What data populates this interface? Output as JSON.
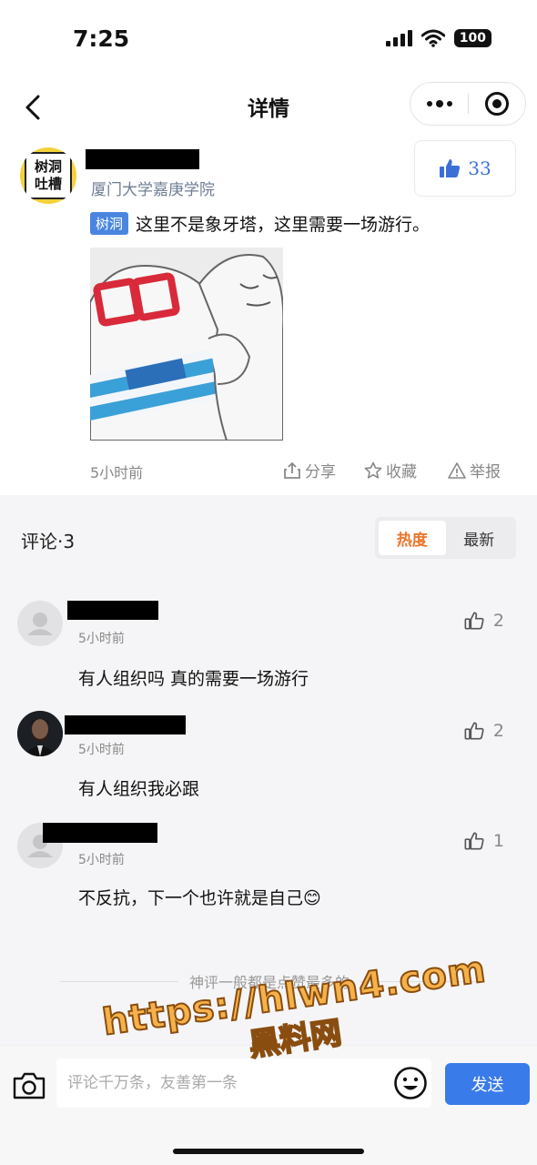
{
  "status_bar": {
    "time": "7:25",
    "battery": "100"
  },
  "nav": {
    "title": "详情"
  },
  "post": {
    "avatar_text_line1": "树洞",
    "avatar_text_line2": "吐槽",
    "school": "厦门大学嘉庚学院",
    "likes": "33",
    "tag": "树洞",
    "text": "这里不是象牙塔，这里需要一场游行。",
    "time": "5小时前",
    "actions": {
      "share": "分享",
      "favorite": "收藏",
      "report": "举报"
    }
  },
  "comments_section": {
    "title": "评论·3",
    "sort_tabs": [
      {
        "label": "热度",
        "active": true
      },
      {
        "label": "最新",
        "active": false
      }
    ],
    "comments": [
      {
        "time": "5小时前",
        "text": "有人组织吗 真的需要一场游行",
        "likes": "2"
      },
      {
        "time": "5小时前",
        "text": "有人组织我必跟",
        "likes": "2"
      },
      {
        "time": "5小时前",
        "text": "不反抗，下一个也许就是自己😊",
        "likes": "1"
      }
    ],
    "tip": "神评一般都是点赞最多的"
  },
  "input_bar": {
    "placeholder": "评论千万条，友善第一条",
    "send_label": "发送"
  },
  "watermark": {
    "line1": "https://hlwn4.com",
    "line2": "黑料网"
  },
  "colors": {
    "accent": "#3a7bea",
    "active_sort": "#e8762d",
    "tag": "#4a86e0",
    "school": "#6f7d93"
  }
}
